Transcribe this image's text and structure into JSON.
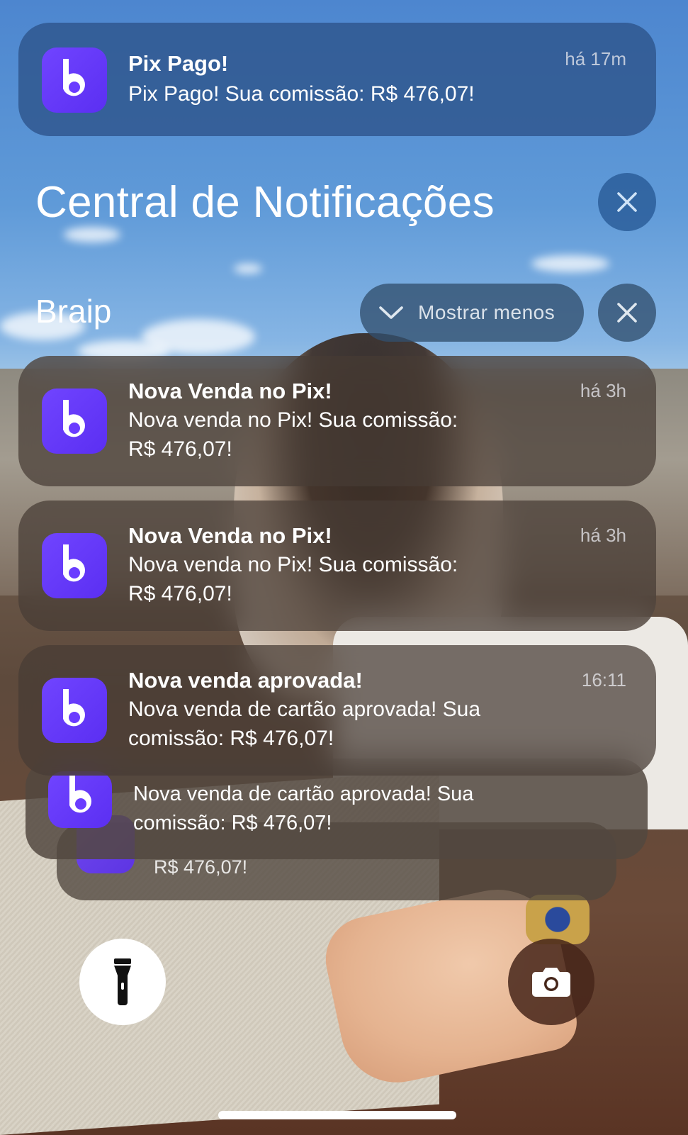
{
  "banner": {
    "title": "Pix Pago!",
    "body": "Pix Pago! Sua comissão: R$ 476,07!",
    "time": "há 17m"
  },
  "center": {
    "title": "Central de Notificações"
  },
  "group": {
    "app_name": "Braip",
    "collapse_label": "Mostrar menos"
  },
  "notifications": [
    {
      "title": "Nova Venda no Pix!",
      "body_line1": "Nova venda no Pix! Sua comissão:",
      "body_line2": "R$ 476,07!",
      "time": "há 3h"
    },
    {
      "title": "Nova Venda no Pix!",
      "body_line1": "Nova venda no Pix! Sua comissão:",
      "body_line2": "R$ 476,07!",
      "time": "há 3h"
    },
    {
      "title": "Nova venda aprovada!",
      "body_line1": "Nova venda de cartão aprovada! Sua",
      "body_line2": "comissão: R$ 476,07!",
      "time": "16:11"
    }
  ],
  "stacked": [
    {
      "body_line1": "Nova venda de cartão aprovada! Sua",
      "body_line2": "comissão: R$ 476,07!"
    },
    {
      "body_line2": "R$ 476,07!"
    }
  ],
  "controls": {
    "flashlight": "flashlight-icon",
    "camera": "camera-icon"
  },
  "colors": {
    "app_icon": "#6a3cff",
    "banner_bg": "#2e568c",
    "close_button_bg": "#285a96"
  }
}
